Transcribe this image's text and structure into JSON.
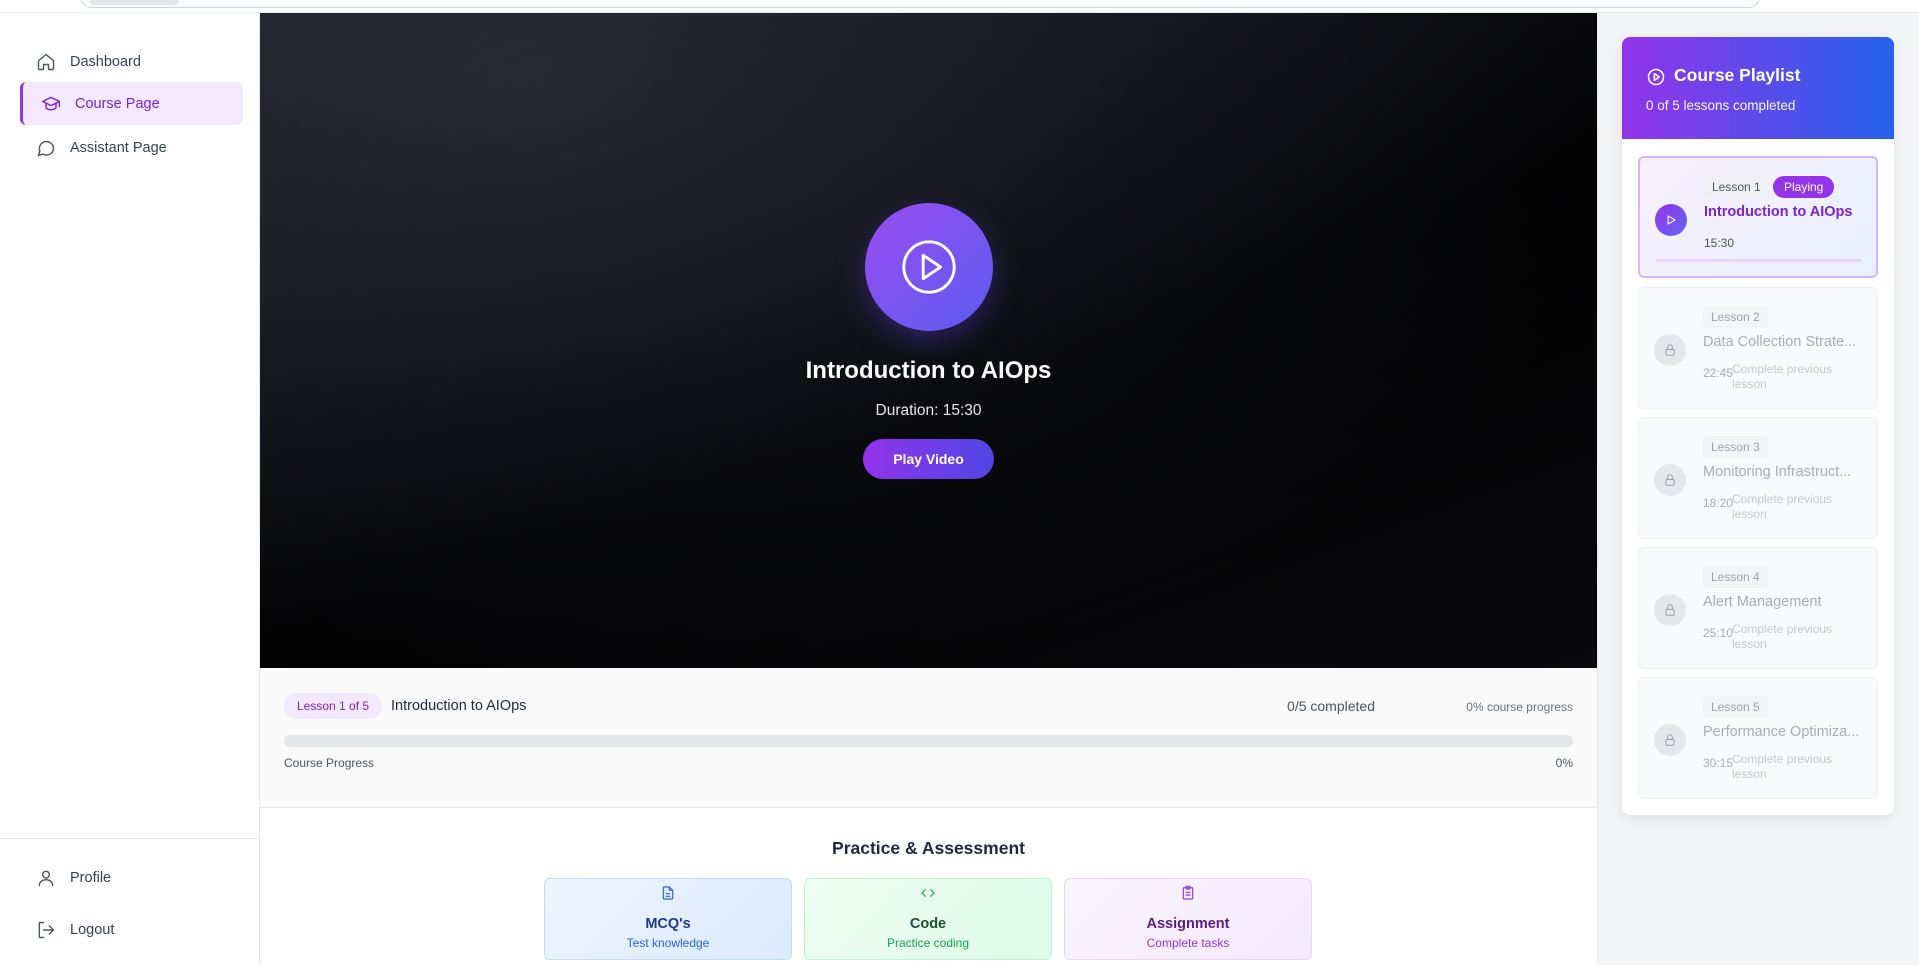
{
  "sidebar": {
    "nav": [
      {
        "label": "Dashboard",
        "icon": "home-icon"
      },
      {
        "label": "Course Page",
        "icon": "graduation-cap-icon",
        "active": true
      },
      {
        "label": "Assistant Page",
        "icon": "chat-bubble-icon"
      }
    ],
    "bottom": [
      {
        "label": "Profile",
        "icon": "user-icon"
      },
      {
        "label": "Logout",
        "icon": "logout-icon"
      }
    ]
  },
  "video": {
    "title": "Introduction to AIOps",
    "duration": "Duration: 15:30",
    "play_label": "Play Video"
  },
  "lesson_info": {
    "badge": "Lesson 1 of 5",
    "name": "Introduction to AIOps",
    "completed": "0/5 completed",
    "course_progress": "0% course progress",
    "progress_label": "Course Progress",
    "progress_percent": "0%",
    "progress_value": 0
  },
  "practice": {
    "title": "Practice & Assessment",
    "cards": [
      {
        "title": "MCQ's",
        "subtitle": "Test knowledge",
        "icon": "document-icon"
      },
      {
        "title": "Code",
        "subtitle": "Practice coding",
        "icon": "code-icon"
      },
      {
        "title": "Assignment",
        "subtitle": "Complete tasks",
        "icon": "clipboard-icon"
      }
    ]
  },
  "playlist": {
    "title": "Course Playlist",
    "subtitle": "0 of 5 lessons completed",
    "lessons": [
      {
        "badge": "Lesson 1",
        "status": "Playing",
        "title": "Introduction to AIOps",
        "duration": "15:30",
        "locked": false
      },
      {
        "badge": "Lesson 2",
        "title": "Data Collection Strate...",
        "duration": "22:45",
        "lock_message": "Complete previous lesson",
        "locked": true
      },
      {
        "badge": "Lesson 3",
        "title": "Monitoring Infrastruct...",
        "duration": "18:20",
        "lock_message": "Complete previous lesson",
        "locked": true
      },
      {
        "badge": "Lesson 4",
        "title": "Alert Management",
        "duration": "25:10",
        "lock_message": "Complete previous lesson",
        "locked": true
      },
      {
        "badge": "Lesson 5",
        "title": "Performance Optimiza...",
        "duration": "30:15",
        "lock_message": "Complete previous lesson",
        "locked": true
      }
    ]
  },
  "colors": {
    "accent": "#9333ea",
    "accent_blue": "#2563eb",
    "active_bg": "#f3e8ff"
  }
}
